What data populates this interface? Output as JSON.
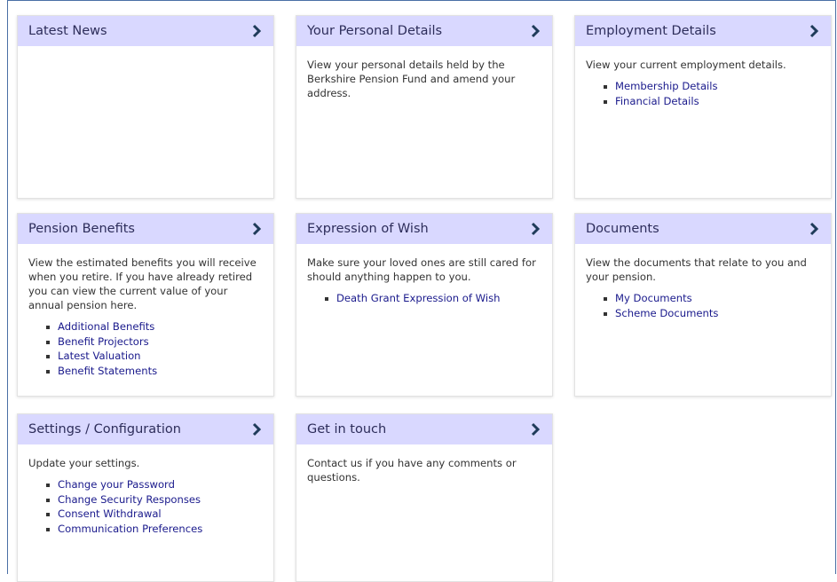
{
  "cards": {
    "news": {
      "title": "Latest News",
      "text": "",
      "links": []
    },
    "personal": {
      "title": "Your Personal Details",
      "text": "View your personal details held by the Berkshire Pension Fund and amend your address.",
      "links": []
    },
    "employment": {
      "title": "Employment Details",
      "text": "View your current employment details.",
      "links": [
        "Membership Details",
        "Financial Details"
      ]
    },
    "pension": {
      "title": "Pension Benefits",
      "text": "View the estimated benefits you will receive when you retire. If you have already retired you can view the current value of your annual pension here.",
      "links": [
        "Additional Benefits",
        "Benefit Projectors",
        "Latest Valuation",
        "Benefit Statements"
      ]
    },
    "wish": {
      "title": "Expression of Wish",
      "text": "Make sure your loved ones are still cared for should anything happen to you.",
      "links": [
        "Death Grant Expression of Wish"
      ]
    },
    "documents": {
      "title": "Documents",
      "text": "View the documents that relate to you and your pension.",
      "links": [
        "My Documents",
        "Scheme Documents"
      ]
    },
    "settings": {
      "title": "Settings / Configuration",
      "text": "Update your settings.",
      "links": [
        "Change your Password",
        "Change Security Responses",
        "Consent Withdrawal",
        "Communication Preferences"
      ]
    },
    "contact": {
      "title": "Get in touch",
      "text": "Contact us if you have any comments or questions.",
      "links": []
    }
  },
  "icons": {
    "header_arrow": "chevron-right-icon"
  },
  "colors": {
    "header_bg": "#d9d8ff",
    "link": "#1a1a8c",
    "chevron": "#1f3b5a"
  }
}
